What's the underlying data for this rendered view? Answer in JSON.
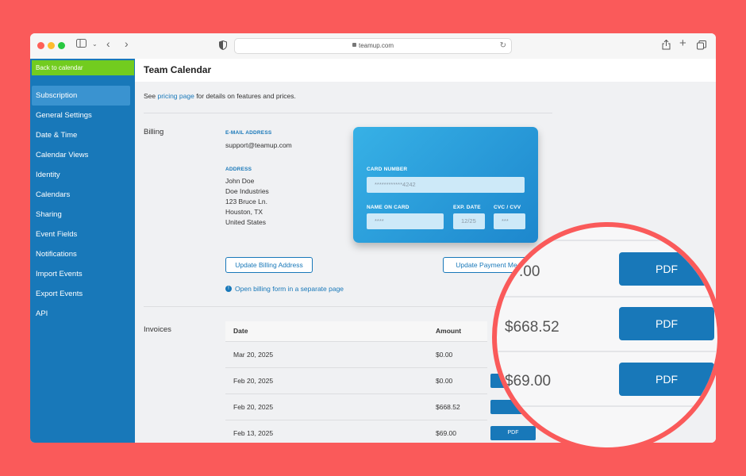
{
  "browser": {
    "url": "teamup.com"
  },
  "sidebar": {
    "back_label": "Back to calendar",
    "items": [
      {
        "label": "Subscription",
        "active": true
      },
      {
        "label": "General Settings"
      },
      {
        "label": "Date & Time"
      },
      {
        "label": "Calendar Views"
      },
      {
        "label": "Identity"
      },
      {
        "label": "Calendars"
      },
      {
        "label": "Sharing"
      },
      {
        "label": "Event Fields"
      },
      {
        "label": "Notifications"
      },
      {
        "label": "Import Events"
      },
      {
        "label": "Export Events"
      },
      {
        "label": "API"
      }
    ]
  },
  "header": {
    "title": "Team Calendar"
  },
  "intro": {
    "prefix": "See",
    "link": "pricing page",
    "suffix": "for details on features and prices."
  },
  "billing": {
    "section_label": "Billing",
    "email_label": "E-MAIL ADDRESS",
    "email": "support@teamup.com",
    "address_label": "ADDRESS",
    "address_lines": [
      "John Doe",
      "Doe Industries",
      "123 Bruce Ln.",
      "Houston, TX",
      "United States"
    ],
    "update_address_label": "Update Billing Address",
    "update_payment_label": "Update Payment Me",
    "open_form_label": "Open billing form in a separate page"
  },
  "card": {
    "number_label": "CARD NUMBER",
    "number": "************4242",
    "name_label": "NAME ON CARD",
    "name": "****",
    "exp_label": "EXP. DATE",
    "exp": "12/25",
    "cvc_label": "CVC / CVV",
    "cvc": "***"
  },
  "invoices": {
    "section_label": "Invoices",
    "columns": [
      "Date",
      "Amount"
    ],
    "rows": [
      {
        "date": "Mar 20, 2025",
        "amount": "$0.00",
        "pdf": ""
      },
      {
        "date": "Feb 20, 2025",
        "amount": "$0.00",
        "pdf": ""
      },
      {
        "date": "Feb 20, 2025",
        "amount": "$668.52",
        "pdf": ""
      },
      {
        "date": "Feb 13, 2025",
        "amount": "$69.00",
        "pdf": "PDF"
      }
    ]
  },
  "zoom": {
    "rows": [
      {
        "amount": ".00",
        "pdf": "PDF"
      },
      {
        "amount": "$668.52",
        "pdf": "PDF"
      },
      {
        "amount": "$69.00",
        "pdf": "PDF"
      }
    ]
  },
  "colors": {
    "accent": "#1878b9",
    "back_button": "#72cc1f",
    "highlight_ring": "#fa5a5a"
  }
}
